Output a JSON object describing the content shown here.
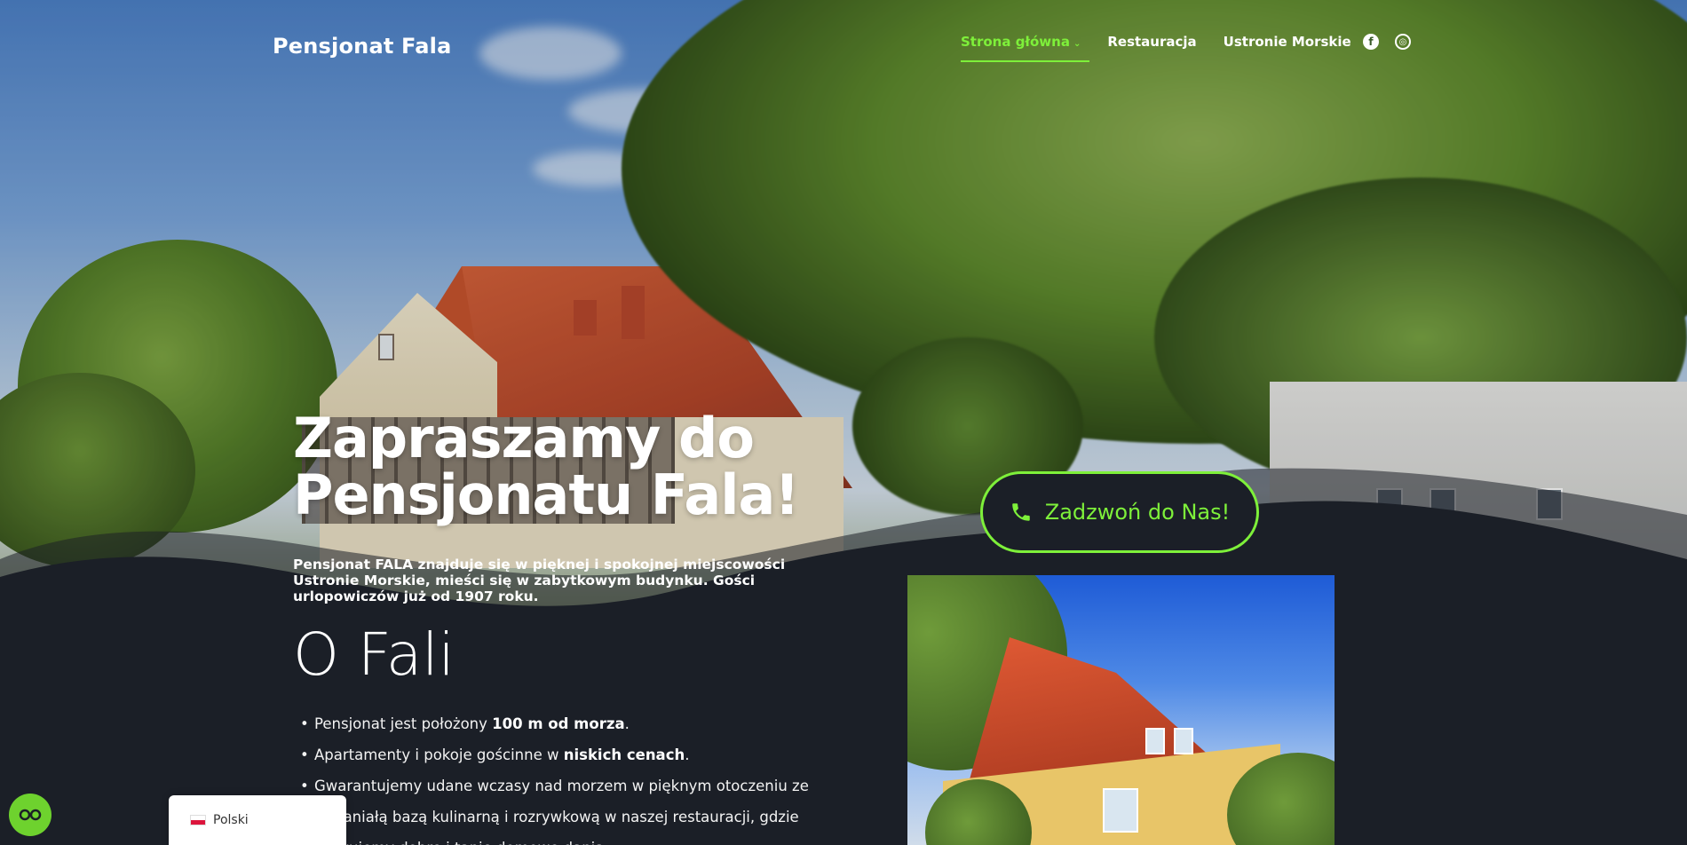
{
  "header": {
    "logo": "Pensjonat Fala",
    "nav": [
      {
        "label": "Strona główna",
        "active": true,
        "has_dropdown": true
      },
      {
        "label": "Restauracja",
        "active": false
      },
      {
        "label": "Ustronie Morskie",
        "active": false
      }
    ],
    "social": [
      {
        "icon": "facebook-icon",
        "glyph": "f"
      },
      {
        "icon": "tripadvisor-icon",
        "glyph": "◎"
      }
    ]
  },
  "hero": {
    "title_line1": "Zapraszamy do",
    "title_line2": "Pensjonatu Fala!",
    "description": "Pensjonat FALA znajduje się w pięknej i spokojnej miejscowości Ustronie Morskie, mieści się w zabytkowym budynku. Gości urlopowiczów już od 1907 roku.",
    "call_button": "Zadzwoń do Nas!"
  },
  "about": {
    "title": "O Fali",
    "items": [
      {
        "pre": "Pensjonat jest położony ",
        "bold": "100 m od morza",
        "post": "."
      },
      {
        "pre": "Apartamenty i pokoje gościnne w ",
        "bold": "niskich cenach",
        "post": "."
      },
      {
        "pre": "Gwarantujemy udane wczasy nad morzem w pięknym otoczeniu ze wspaniałą bazą kulinarną i rozrywkową w naszej restauracji, gdzie serwujemy dobre i tanie domowe dania.",
        "bold": "",
        "post": ""
      }
    ]
  },
  "language": {
    "label": "Polski"
  },
  "colors": {
    "accent": "#7ef03a",
    "dark": "#1b1f27"
  }
}
